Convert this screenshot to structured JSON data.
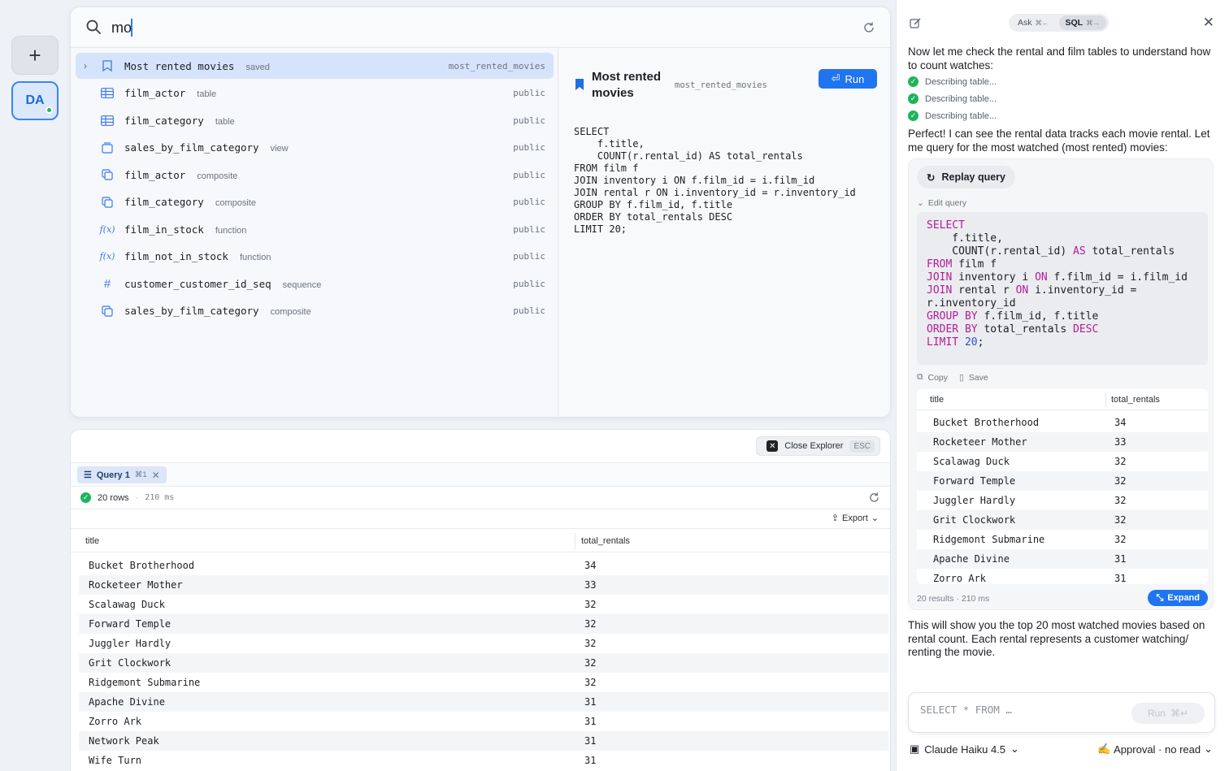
{
  "rail": {
    "add_label": "+",
    "avatar_label": "DA"
  },
  "search": {
    "value": "mo",
    "placeholder": ""
  },
  "results": [
    {
      "name": "Most rented movies",
      "kind": "saved",
      "schema": "most_rented_movies",
      "icon": "bookmark-icon",
      "selected": true
    },
    {
      "name": "film_actor",
      "kind": "table",
      "schema": "public",
      "icon": "table-icon"
    },
    {
      "name": "film_category",
      "kind": "table",
      "schema": "public",
      "icon": "table-icon"
    },
    {
      "name": "sales_by_film_category",
      "kind": "view",
      "schema": "public",
      "icon": "view-icon"
    },
    {
      "name": "film_actor",
      "kind": "composite",
      "schema": "public",
      "icon": "composite-icon"
    },
    {
      "name": "film_category",
      "kind": "composite",
      "schema": "public",
      "icon": "composite-icon"
    },
    {
      "name": "film_in_stock",
      "kind": "function",
      "schema": "public",
      "icon": "function-icon"
    },
    {
      "name": "film_not_in_stock",
      "kind": "function",
      "schema": "public",
      "icon": "function-icon"
    },
    {
      "name": "customer_customer_id_seq",
      "kind": "sequence",
      "schema": "public",
      "icon": "sequence-icon"
    },
    {
      "name": "sales_by_film_category",
      "kind": "composite",
      "schema": "public",
      "icon": "composite-icon"
    }
  ],
  "preview": {
    "title": "Most rented movies",
    "slug": "most_rented_movies",
    "run_label": "Run",
    "sql": "SELECT\n    f.title,\n    COUNT(r.rental_id) AS total_rentals\nFROM film f\nJOIN inventory i ON f.film_id = i.film_id\nJOIN rental r ON i.inventory_id = r.inventory_id\nGROUP BY f.film_id, f.title\nORDER BY total_rentals DESC\nLIMIT 20;"
  },
  "bottom": {
    "close_label": "Close Explorer",
    "close_shortcut": "ESC",
    "tab_label": "Query 1",
    "tab_shortcut": "⌘1",
    "rows_count": "20 rows",
    "elapsed": "210 ms",
    "export_label": "Export",
    "columns": [
      "title",
      "total_rentals"
    ],
    "rows": [
      [
        "Bucket Brotherhood",
        "34"
      ],
      [
        "Rocketeer Mother",
        "33"
      ],
      [
        "Scalawag Duck",
        "32"
      ],
      [
        "Forward Temple",
        "32"
      ],
      [
        "Juggler Hardly",
        "32"
      ],
      [
        "Grit Clockwork",
        "32"
      ],
      [
        "Ridgemont Submarine",
        "32"
      ],
      [
        "Apache Divine",
        "31"
      ],
      [
        "Zorro Ark",
        "31"
      ],
      [
        "Network Peak",
        "31"
      ],
      [
        "Wife Turn",
        "31"
      ]
    ]
  },
  "chat": {
    "mode_ask": "Ask",
    "mode_ask_key": "⌘←",
    "mode_sql": "SQL",
    "mode_sql_key": "⌘→",
    "msg1": "Now let me check the rental and film tables to understand how to count watches:",
    "steps": [
      "Describing table...",
      "Describing table...",
      "Describing table..."
    ],
    "msg2": "Perfect! I can see the rental data tracks each movie rental. Let me query for the most watched (most rented) movies:",
    "replay_label": "Replay query",
    "edit_label": "Edit query",
    "copy_label": "Copy",
    "save_label": "Save",
    "mini_columns": [
      "title",
      "total_rentals"
    ],
    "mini_rows": [
      [
        "Bucket Brotherhood",
        "34"
      ],
      [
        "Rocketeer Mother",
        "33"
      ],
      [
        "Scalawag Duck",
        "32"
      ],
      [
        "Forward Temple",
        "32"
      ],
      [
        "Juggler Hardly",
        "32"
      ],
      [
        "Grit Clockwork",
        "32"
      ],
      [
        "Ridgemont Submarine",
        "32"
      ],
      [
        "Apache Divine",
        "31"
      ],
      [
        "Zorro Ark",
        "31"
      ]
    ],
    "results_count": "20 results",
    "results_ms": "210 ms",
    "expand_label": "Expand",
    "msg3": "This will show you the top 20 most watched movies based on rental count. Each rental represents a customer watching/ renting the movie.",
    "input_placeholder": "SELECT * FROM …",
    "input_run": "Run",
    "input_run_key": "⌘↵",
    "model": "Claude Haiku 4.5",
    "approval": "Approval · no read"
  }
}
